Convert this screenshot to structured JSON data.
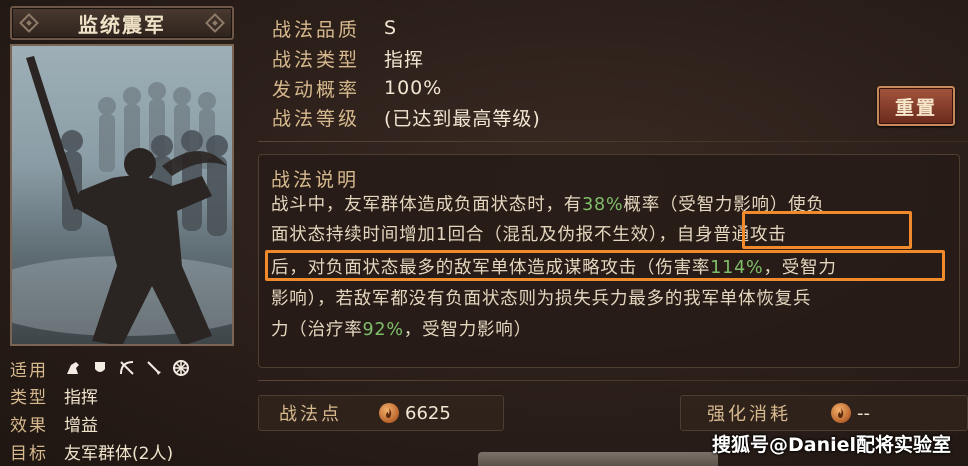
{
  "left": {
    "title": "监统震军",
    "stats": {
      "applicable_label": "适用",
      "type_label": "类型",
      "type_value": "指挥",
      "effect_label": "效果",
      "effect_value": "增益",
      "target_label": "目标",
      "target_value": "友军群体(2人)"
    },
    "unit_icons": [
      "cavalry-icon",
      "shield-icon",
      "bow-icon",
      "spear-icon",
      "wheel-icon"
    ]
  },
  "info": {
    "quality_label": "战法品质",
    "quality_value": "S",
    "type_label": "战法类型",
    "type_value": "指挥",
    "rate_label": "发动概率",
    "rate_value": "100%",
    "level_label": "战法等级",
    "level_value": "(已达到最高等级)",
    "reset_button": "重置"
  },
  "description": {
    "title": "战法说明",
    "line1_a": "战斗中，友军群体造成负面状态时，有",
    "line1_b": "38%",
    "line1_c": "概率（受智力影响）使负",
    "line2_a": "面状态持续时间增加1回合（混乱及伪报不生效）",
    "line2_b": "，自身普通攻击",
    "line3_a": "后，对负面状态最多的敌军单体造成谋略攻击（伤害率",
    "line3_b": "114%",
    "line3_c": "，受智力",
    "line4": "影响），若敌军都没有负面状态则为损失兵力最多的我军单体恢复兵",
    "line5_a": "力（治疗率",
    "line5_b": "92%",
    "line5_c": "，受智力影响）",
    "highlight_color": "#7fbf6a",
    "box_color": "#f08a2b"
  },
  "bottom": {
    "points_label": "战法点",
    "points_value": "6625",
    "enhance_label": "强化消耗",
    "enhance_value": "--"
  },
  "watermark": "搜狐号@Daniel配将实验室"
}
